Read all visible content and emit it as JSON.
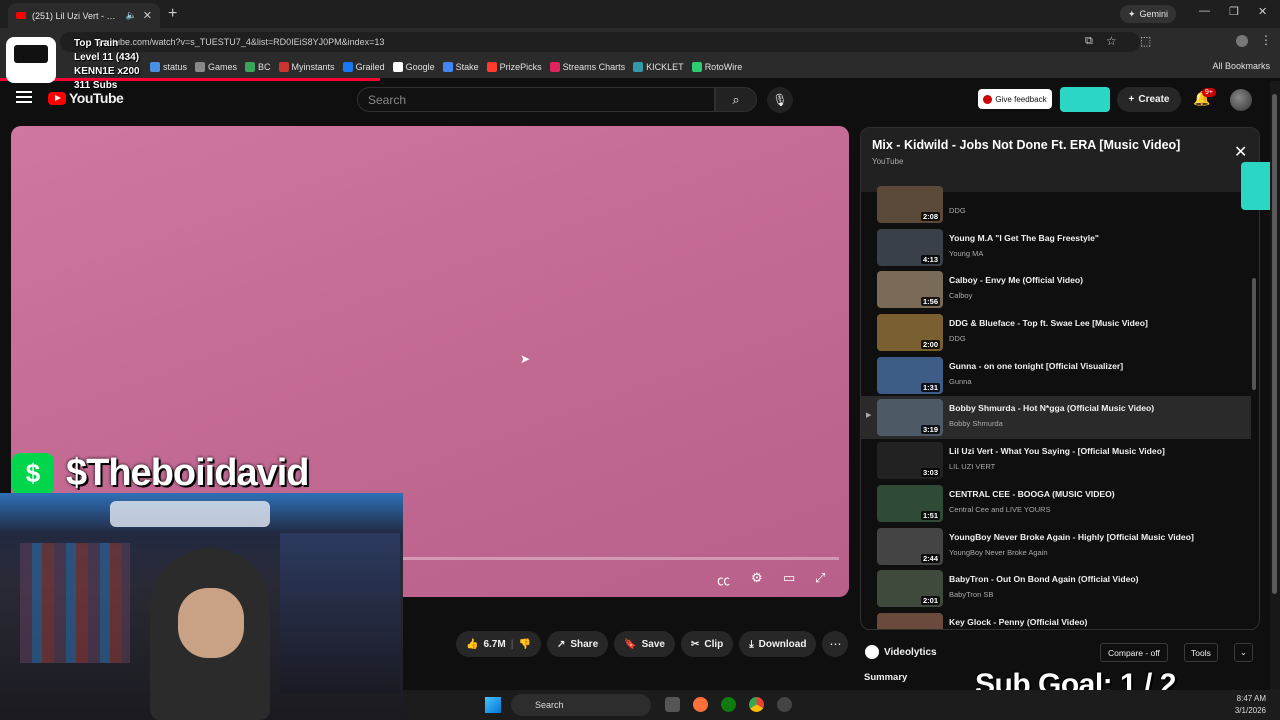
{
  "browser": {
    "tab_title": "(251) Lil Uzi Vert - What Yo",
    "new_tab": "+",
    "gemini": "Gemini",
    "url": "youtube.com/watch?v=s_TUESTU7_4&list=RD0IEiS8YJ0PM&index=13",
    "bookmarks": [
      "status",
      "Games",
      "BC",
      "Myinstants",
      "Grailed",
      "Google",
      "Stake",
      "PrizePicks",
      "Streams Charts",
      "KICKLET",
      "RotoWire"
    ],
    "all_bookmarks": "All Bookmarks"
  },
  "youtube": {
    "logo": "YouTube",
    "search_placeholder": "Search",
    "give_feedback": "Give feedback",
    "create": "Create",
    "notif_badge": "9+"
  },
  "actions": {
    "likes": "6.7M",
    "share": "Share",
    "save": "Save",
    "clip": "Clip",
    "download": "Download"
  },
  "overlay": {
    "train_lines": [
      "Top Train",
      "Level 11  (434)",
      "KENN1E x200",
      "311 Subs"
    ],
    "cashtag": "$Theboiidavid",
    "sub_goal": "Sub Goal:  1 / 2"
  },
  "playlist": {
    "title": "Mix - Kidwild - Jobs Not Done Ft. ERA [Music Video]",
    "subtitle": "YouTube",
    "items": [
      {
        "title": "",
        "channel": "DDG",
        "duration": "2:08",
        "color": "#5b4a3a"
      },
      {
        "title": "Young M.A \"I Get The Bag Freestyle\"",
        "channel": "Young MA",
        "duration": "4:13",
        "color": "#3a4048"
      },
      {
        "title": "Calboy - Envy Me (Official Video)",
        "channel": "Calboy",
        "duration": "1:56",
        "color": "#7a6a58"
      },
      {
        "title": "DDG & Blueface - Top ft. Swae Lee [Music Video]",
        "channel": "DDG",
        "duration": "2:00",
        "color": "#7a6030"
      },
      {
        "title": "Gunna - on one tonight [Official Visualizer]",
        "channel": "Gunna",
        "duration": "1:31",
        "color": "#3d5d86"
      },
      {
        "title": "Bobby Shmurda - Hot N*gga (Official Music Video)",
        "channel": "Bobby Shmurda",
        "duration": "3:19",
        "color": "#4d5a66"
      },
      {
        "title": "Lil Uzi Vert - What You Saying - [Official Music Video]",
        "channel": "LIL UZI VERT",
        "duration": "3:03",
        "color": "#222"
      },
      {
        "title": "CENTRAL CEE - BOOGA (MUSIC VIDEO)",
        "channel": "Central Cee and LIVE YOURS",
        "duration": "1:51",
        "color": "#2f4a35"
      },
      {
        "title": "YoungBoy Never Broke Again - Highly [Official Music Video]",
        "channel": "YoungBoy Never Broke Again",
        "duration": "2:44",
        "color": "#444"
      },
      {
        "title": "BabyTron - Out On Bond Again (Official Video)",
        "channel": "BabyTron SB",
        "duration": "2:01",
        "color": "#3f4a3c"
      },
      {
        "title": "Key Glock - Penny (Official Video)",
        "channel": "Key Glock",
        "duration": "",
        "color": "#6a4a3a"
      }
    ],
    "active_index": 5
  },
  "videolytics": {
    "title": "Videolytics",
    "compare": "Compare - off",
    "tools": "Tools",
    "summary": "Summary"
  },
  "taskbar": {
    "search": "Search",
    "time": "8:47 AM",
    "date": "3/1/2026"
  }
}
